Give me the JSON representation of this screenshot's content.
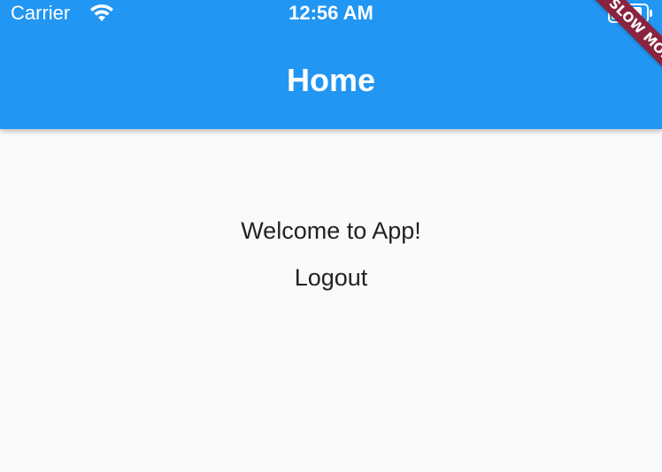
{
  "status_bar": {
    "carrier": "Carrier",
    "time": "12:56 AM",
    "wifi_icon": "wifi-icon",
    "battery_icon": "battery-icon",
    "battery_level": 0.9
  },
  "app_bar": {
    "title": "Home",
    "color": "#2196f3"
  },
  "debug_banner": {
    "label": "SLOW MODE",
    "color": "#8a2340"
  },
  "main": {
    "welcome_text": "Welcome to App!",
    "logout_label": "Logout",
    "background": "#fafafa"
  }
}
